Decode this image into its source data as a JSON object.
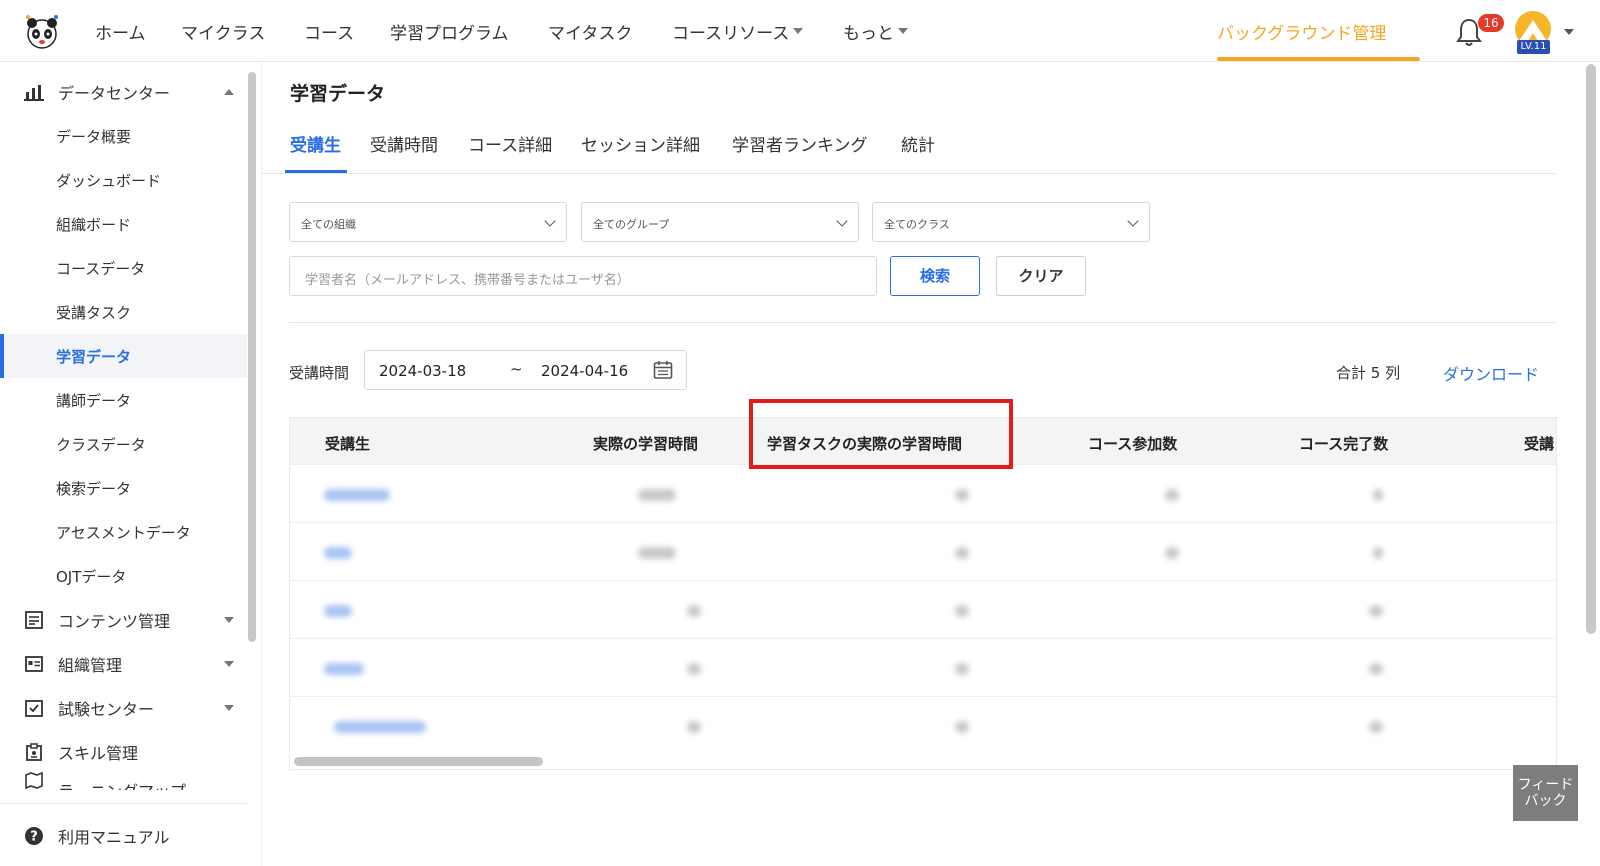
{
  "nav": {
    "items": [
      "ホーム",
      "マイクラス",
      "コース",
      "学習プログラム",
      "マイタスク",
      "コースリソース",
      "もっと"
    ],
    "admin": "バックグラウンド管理",
    "notification_count": "16",
    "level": "LV.11"
  },
  "sidebar": {
    "data_center": "データセンター",
    "sub_items": [
      "データ概要",
      "ダッシュボード",
      "組織ボード",
      "コースデータ",
      "受講タスク",
      "学習データ",
      "講師データ",
      "クラスデータ",
      "検索データ",
      "アセスメントデータ",
      "OJTデータ"
    ],
    "active_item": "学習データ",
    "groups": [
      "コンテンツ管理",
      "組織管理",
      "試験センター",
      "スキル管理",
      "ラーニングマップ"
    ],
    "manual": "利用マニュアル"
  },
  "page": {
    "title": "学習データ",
    "tabs": [
      "受講生",
      "受講時間",
      "コース詳細",
      "セッション詳細",
      "学習者ランキング",
      "統計"
    ],
    "active_tab": "受講生"
  },
  "filters": {
    "org": "全ての組織",
    "group": "全てのグループ",
    "class": "全てのクラス",
    "search_placeholder": "学習者名（メールアドレス、携帯番号またはユーザ名）",
    "search_button": "検索",
    "clear_button": "クリア"
  },
  "range": {
    "label": "受講時間",
    "start": "2024-03-18",
    "separator": "~",
    "end": "2024-04-16",
    "total": "合計 5 列",
    "download": "ダウンロード"
  },
  "table": {
    "headers": [
      "受講生",
      "実際の学習時間",
      "学習タスクの実際の学習時間",
      "コース参加数",
      "コース完了数",
      "受講"
    ],
    "row_count": 5
  },
  "feedback": "フィード\nバック",
  "colors": {
    "accent": "#2a6de8",
    "admin": "#f5a623",
    "highlight": "#e21b1b",
    "badge": "#e4392b"
  }
}
